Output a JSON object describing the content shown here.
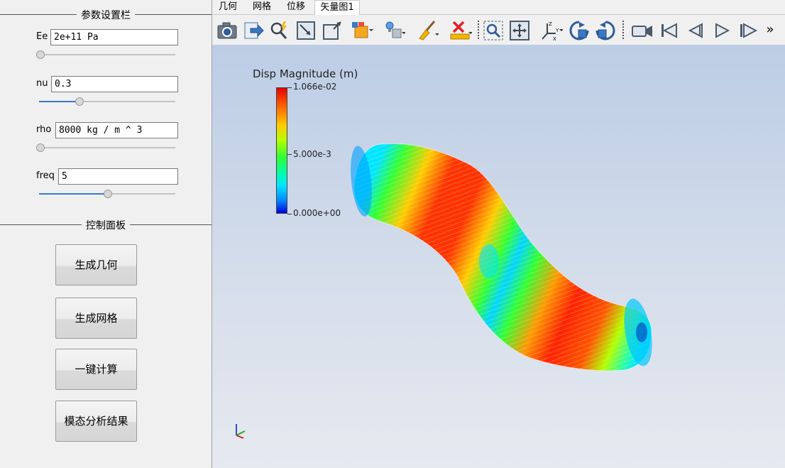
{
  "left_panel": {
    "params_group_title": "参数设置栏",
    "params": [
      {
        "label": "Ee",
        "value": "2e+11 Pa",
        "slider_fraction": 0.0
      },
      {
        "label": "nu",
        "value": "0.3",
        "slider_fraction": 0.3
      },
      {
        "label": "rho",
        "value": "8000 kg / m ^ 3",
        "slider_fraction": 0.0
      },
      {
        "label": "freq",
        "value": "5",
        "slider_fraction": 0.5
      }
    ],
    "control_group_title": "控制面板",
    "buttons": [
      "生成几何",
      "生成网格",
      "一键计算",
      "模态分析结果"
    ]
  },
  "tabs": [
    {
      "label": "几何",
      "active": false
    },
    {
      "label": "网格",
      "active": false
    },
    {
      "label": "位移",
      "active": false
    },
    {
      "label": "矢量图1",
      "active": true
    }
  ],
  "toolbar": {
    "icons": [
      "camera-icon",
      "export-icon",
      "zoom-to-data-icon",
      "zoom-to-box-icon",
      "frame-icon",
      "surface-representation-icon",
      "light-icon",
      "clear-brush-icon",
      "ruler-delete-icon",
      "zoom-select-icon",
      "reset-camera-icon",
      "axes-orientation-icon",
      "rotate-cw-icon",
      "rotate-ccw-icon",
      "video-camera-icon",
      "first-frame-icon",
      "prev-frame-icon",
      "play-icon",
      "next-frame-icon",
      "more-icon"
    ],
    "more_label": "»"
  },
  "viewport": {
    "legend": {
      "title": "Disp Magnitude (m)",
      "max_label": "1.066e-02",
      "mid_label": "5.000e-3",
      "min_label": "0.000e+00"
    },
    "colors": {
      "high": "#e60000",
      "mid": "#33ff33",
      "low": "#0000dd",
      "background_top": "#bccde5",
      "background_bottom": "#e6e9f0"
    }
  }
}
